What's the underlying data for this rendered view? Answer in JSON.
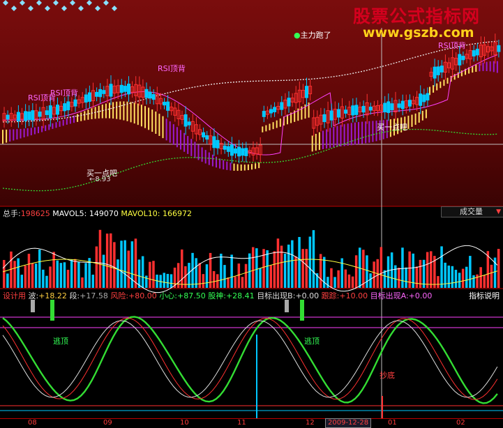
{
  "watermark": {
    "title": "股票公式指标网",
    "url": "www.gszb.com"
  },
  "main": {
    "annotations": {
      "main_force_run": "主力跑了",
      "rsi_top_1": "RSI顶背",
      "rsi_top_2": "RSI顶背",
      "rsi_top_3": "RSI顶背",
      "rsi_top_4": "RSI顶背",
      "buy_1": "买一点吧",
      "buy_2": "买一点吧",
      "low_price": "8.93"
    }
  },
  "volume": {
    "total_label": "总手:",
    "total_value": "198625",
    "ma5_label": "MAVOL5:",
    "ma5_value": "149070",
    "ma10_label": "MAVOL10:",
    "ma10_value": "166972",
    "indicator_select": "成交量"
  },
  "indicator": {
    "setting": "设计用",
    "wave_label": "波:",
    "wave_value": "+18.22",
    "segment_label": "段:",
    "segment_value": "+17.58",
    "risk_label": "风险:",
    "risk_value": "+80.00",
    "careful_label": "小心:",
    "careful_value": "+87.50",
    "stock_god_label": "股神:",
    "stock_god_value": "+28.41",
    "target_b_label": "目标出现B:",
    "target_b_value": "+0.00",
    "follow_label": "跟踪:",
    "follow_value": "+10.00",
    "target_a_label": "目标出现A:",
    "target_a_value": "+0.00",
    "help": "指标说明",
    "escape_top_1": "逃顶",
    "escape_top_2": "逃顶",
    "bottom_fish": "抄底"
  },
  "time_axis": {
    "ticks": [
      "08",
      "09",
      "10",
      "11",
      "12",
      "01",
      "02"
    ],
    "cursor_date": "2009-12-28"
  },
  "colors": {
    "up": "#ff3030",
    "down": "#00c8ff",
    "green_line": "#33dd33",
    "magenta": "#ff40ff",
    "yellow": "#ffe060",
    "purple": "#9a1ad0"
  }
}
